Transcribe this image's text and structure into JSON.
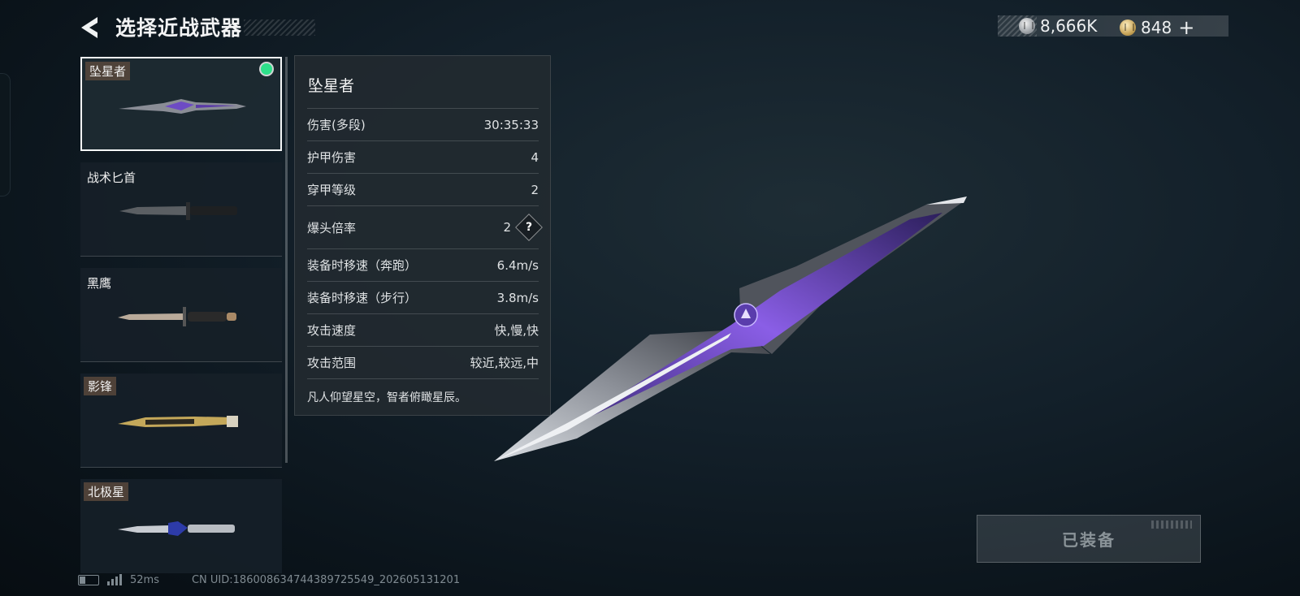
{
  "header": {
    "title": "选择近战武器"
  },
  "currency": {
    "silver_value": "8,666K",
    "gold_value": "848",
    "plus_label": "+"
  },
  "weapons": [
    {
      "name": "坠星者",
      "selected": true,
      "equipped": true
    },
    {
      "name": "战术匕首",
      "selected": false,
      "equipped": false
    },
    {
      "name": "黑鹰",
      "selected": false,
      "equipped": false
    },
    {
      "name": "影锋",
      "selected": false,
      "equipped": false
    },
    {
      "name": "北极星",
      "selected": false,
      "equipped": false
    }
  ],
  "stats": {
    "title": "坠星者",
    "rows": [
      {
        "label": "伤害(多段)",
        "value": "30:35:33"
      },
      {
        "label": "护甲伤害",
        "value": "4"
      },
      {
        "label": "穿甲等级",
        "value": "2"
      },
      {
        "label": "爆头倍率",
        "value": "2",
        "help": "?"
      },
      {
        "label": "装备时移速（奔跑）",
        "value": "6.4m/s"
      },
      {
        "label": "装备时移速（步行）",
        "value": "3.8m/s"
      },
      {
        "label": "攻击速度",
        "value": "快,慢,快"
      },
      {
        "label": "攻击范围",
        "value": "较近,较远,中"
      }
    ],
    "flavor_text": "凡人仰望星空，智者俯瞰星辰。"
  },
  "equip_button": {
    "label": "已装备"
  },
  "status_bar": {
    "ping": "52ms",
    "uid": "CN UID:18600863474438972554​9_202605131201"
  },
  "colors": {
    "equipped_dot": "#2ee08a",
    "blade_purple": "#7b4fd6",
    "name_tag_bg": "#58483c"
  }
}
